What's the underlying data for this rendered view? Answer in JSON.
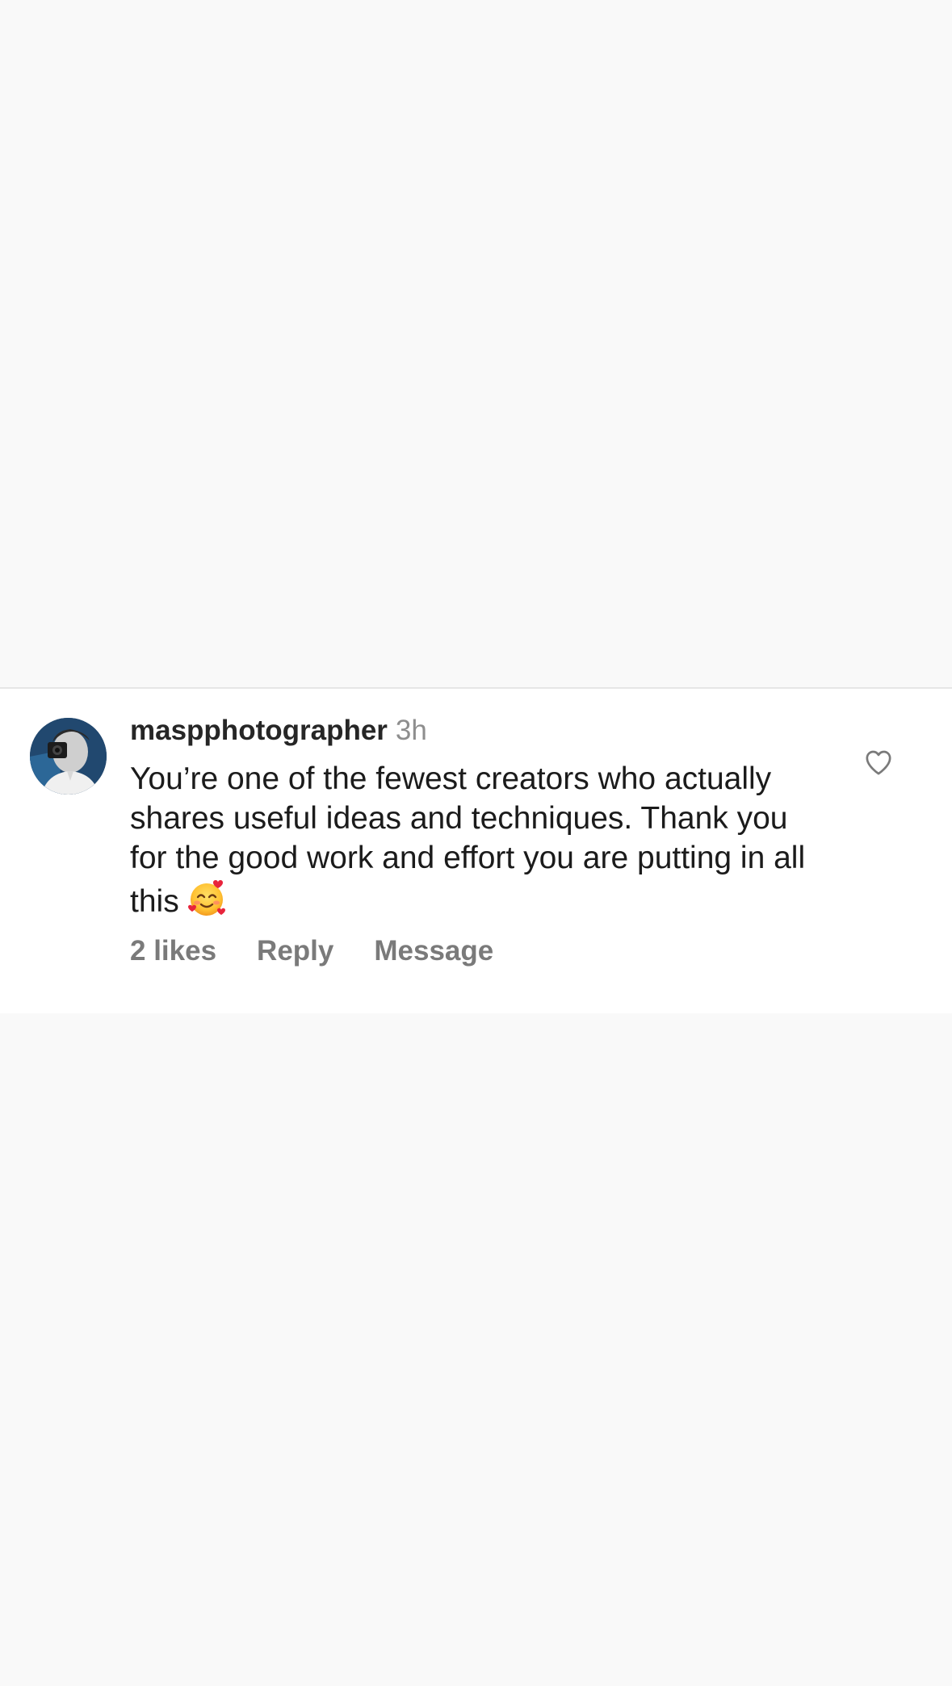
{
  "comment": {
    "username": "maspphotographer",
    "time": "3h",
    "text": "You’re one of the fewest creators who actually shares useful ideas and techniques. Thank you for the good work and effort you are putting in all this",
    "emoji": "smiling-face-with-hearts-icon",
    "likes": "2 likes",
    "reply_label": "Reply",
    "message_label": "Message",
    "liked": false
  },
  "colors": {
    "background": "#f9f9f9",
    "card": "#ffffff",
    "username": "#262626",
    "secondary": "#8e8e8e",
    "actions": "#7a7a7a"
  }
}
